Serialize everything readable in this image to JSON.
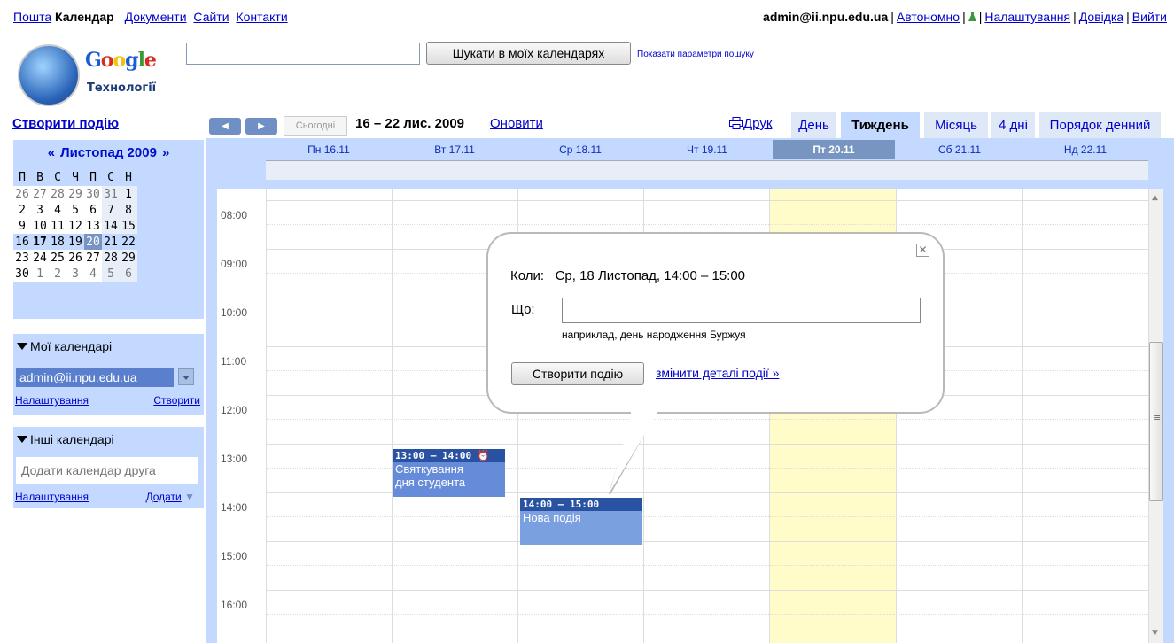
{
  "topnav": {
    "links": [
      "Пошта",
      "Календар",
      "Документи",
      "Сайти",
      "Контакти"
    ],
    "user": "admin@ii.npu.edu.ua",
    "offline": "Автономно",
    "settings": "Налаштування",
    "help": "Довідка",
    "logout": "Вийти"
  },
  "logo": {
    "brand": "Google",
    "subtitle": "Технології"
  },
  "search": {
    "value": "",
    "button": "Шукати в моїх календарях",
    "options_link": "Показати параметри пошуку"
  },
  "toolbar": {
    "create_event": "Створити подію",
    "today": "Сьогодні",
    "date_range": "16 – 22 лис. 2009",
    "refresh": "Оновити",
    "print": "Друк",
    "views": [
      "День",
      "Тиждень",
      "Місяць",
      "4 дні",
      "Порядок денний"
    ],
    "current_view": "Тиждень"
  },
  "minical": {
    "title": "Листопад 2009",
    "prev": "«",
    "next": "»",
    "dow": [
      "П",
      "В",
      "С",
      "Ч",
      "П",
      "С",
      "Н"
    ],
    "weeks": [
      [
        "26",
        "27",
        "28",
        "29",
        "30",
        "31",
        "1"
      ],
      [
        "2",
        "3",
        "4",
        "5",
        "6",
        "7",
        "8"
      ],
      [
        "9",
        "10",
        "11",
        "12",
        "13",
        "14",
        "15"
      ],
      [
        "16",
        "17",
        "18",
        "19",
        "20",
        "21",
        "22"
      ],
      [
        "23",
        "24",
        "25",
        "26",
        "27",
        "28",
        "29"
      ],
      [
        "30",
        "1",
        "2",
        "3",
        "4",
        "5",
        "6"
      ]
    ]
  },
  "my_calendars": {
    "title": "Мої календарі",
    "calendar": "admin@ii.npu.edu.ua",
    "settings": "Налаштування",
    "create": "Створити"
  },
  "other_calendars": {
    "title": "Інші календарі",
    "placeholder": "Додати календар друга",
    "settings": "Налаштування",
    "add": "Додати"
  },
  "week": {
    "days": [
      "Пн 16.11",
      "Вт 17.11",
      "Ср 18.11",
      "Чт 19.11",
      "Пт 20.11",
      "Сб 21.11",
      "Нд 22.11"
    ],
    "today_label": "Пт 20.11",
    "hours": [
      "08:00",
      "09:00",
      "10:00",
      "11:00",
      "12:00",
      "13:00",
      "14:00",
      "15:00",
      "16:00"
    ]
  },
  "events": [
    {
      "time": "13:00 – 14:00",
      "title_l1": "Святкування",
      "title_l2": "дня студента",
      "day": "Вт 17.11"
    },
    {
      "time": "14:00 – 15:00",
      "title_l1": "Нова подія",
      "day": "Ср 18.11"
    }
  ],
  "bubble": {
    "when_label": "Коли:",
    "when_value": "Ср, 18 Листопад, 14:00 – 15:00",
    "what_label": "Що:",
    "what_value": "",
    "hint": "наприклад, день народження Буржуя",
    "create_button": "Створити подію",
    "edit_link": "змінити деталі події »",
    "close": "✕"
  },
  "colors": {
    "panel": "#c3d9ff",
    "event_header": "#2952a3",
    "event_body": "#668cd9",
    "today_col": "#fffcca",
    "link": "#0000cc"
  }
}
